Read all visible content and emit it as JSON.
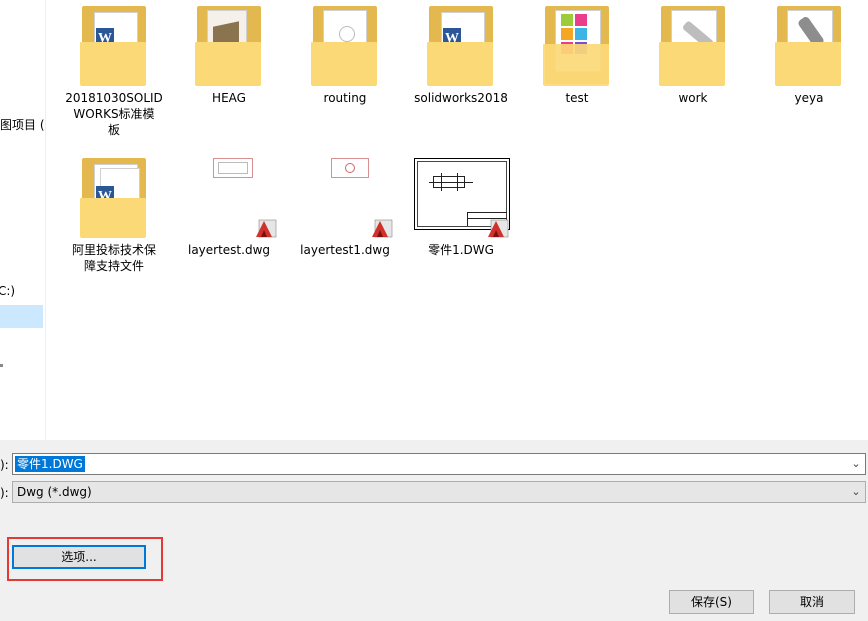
{
  "nav": {
    "item_1": "图项目 (",
    "item_2": "C:)"
  },
  "files": [
    {
      "name": "20181030SOLIDWORKS标准模板",
      "kind": "folder-word"
    },
    {
      "name": "HEAG",
      "kind": "folder-model"
    },
    {
      "name": "routing",
      "kind": "folder-drawing"
    },
    {
      "name": "solidworks2018",
      "kind": "folder-word"
    },
    {
      "name": "test",
      "kind": "folder-colorful"
    },
    {
      "name": "work",
      "kind": "folder-tool"
    },
    {
      "name": "yeya",
      "kind": "folder-tool"
    },
    {
      "name": "阿里投标技术保障支持文件",
      "kind": "folder-word"
    },
    {
      "name": "layertest.dwg",
      "kind": "dwg-rect"
    },
    {
      "name": "layertest1.dwg",
      "kind": "dwg-circle"
    },
    {
      "name": "零件1.DWG",
      "kind": "dwg-drawing"
    }
  ],
  "labels": {
    "l1": "20181030SOLID",
    "l2": "WORKS标准模",
    "l3": "板",
    "heag": "HEAG",
    "routing": "routing",
    "sw": "solidworks2018",
    "test": "test",
    "work": "work",
    "yeya": "yeya",
    "ali1": "阿里投标技术保",
    "ali2": "障支持文件",
    "lt": "layertest.dwg",
    "lt1": "layertest1.dwg",
    "part": "零件1.DWG"
  },
  "form": {
    "filename_label": "):",
    "filename_value": "零件1.DWG",
    "filetype_label": "):",
    "filetype_value": "Dwg (*.dwg)"
  },
  "buttons": {
    "options": "选项...",
    "save": "保存(S)",
    "cancel": "取消"
  },
  "colors": {
    "selection": "#0078d7",
    "highlight_box": "#e53935",
    "folder": "#fcd977"
  }
}
